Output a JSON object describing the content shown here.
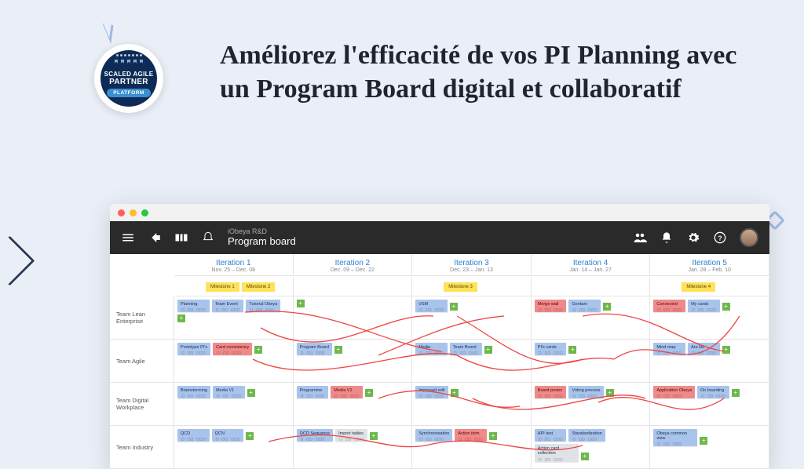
{
  "hero": {
    "headline": "Améliorez l'efficacité de vos PI Planning avec un Program Board digital et collaboratif",
    "badge_line1": "SCALED AGILE",
    "badge_line2": "PARTNER",
    "badge_pill": "PLATFORM"
  },
  "app": {
    "subtitle": "iObeya R&D",
    "title": "Program board"
  },
  "columns": [
    {
      "name": "Iteration 1",
      "date": "Nov. 25 – Dec. 08"
    },
    {
      "name": "Iteration 2",
      "date": "Dec. 09 – Dec. 22"
    },
    {
      "name": "Iteration 3",
      "date": "Dec. 23 – Jan. 13"
    },
    {
      "name": "Iteration 4",
      "date": "Jan. 14 – Jan. 27"
    },
    {
      "name": "Iteration 5",
      "date": "Jan. 28 – Feb. 10"
    }
  ],
  "milestones": [
    [
      "Milestone 1",
      "Milestone 2"
    ],
    [],
    [
      "Milestone 3"
    ],
    [],
    [
      "Milestone 4"
    ]
  ],
  "teams": [
    "Team Lean Enterprise",
    "Team Agile",
    "Team Digital Workplace",
    "Team Industry"
  ],
  "grid": [
    [
      [
        {
          "t": "Planning",
          "c": "blue"
        },
        {
          "t": "Team Event",
          "c": "blue"
        },
        {
          "t": "Tutorial Obeya",
          "c": "blue"
        }
      ],
      [],
      [
        {
          "t": "VSM",
          "c": "blue"
        }
      ],
      [
        {
          "t": "Merge wall",
          "c": "red"
        },
        {
          "t": "Gentani",
          "c": "blue"
        }
      ],
      [
        {
          "t": "Connected",
          "c": "red"
        },
        {
          "t": "My cards",
          "c": "blue"
        }
      ]
    ],
    [
      [
        {
          "t": "Prototype PI's",
          "c": "blue"
        },
        {
          "t": "Card consistency",
          "c": "red"
        }
      ],
      [
        {
          "t": "Program Board",
          "c": "blue"
        }
      ],
      [
        {
          "t": "Media",
          "c": "blue"
        },
        {
          "t": "Team Board",
          "c": "blue"
        }
      ],
      [
        {
          "t": "PI's cards",
          "c": "blue"
        }
      ],
      [
        {
          "t": "Mind map",
          "c": "blue"
        },
        {
          "t": "Are list",
          "c": "blue"
        }
      ]
    ],
    [
      [
        {
          "t": "Brainstorming",
          "c": "blue"
        },
        {
          "t": "Media V1",
          "c": "blue"
        }
      ],
      [
        {
          "t": "Programme",
          "c": "blue"
        },
        {
          "t": "Media V1",
          "c": "red"
        }
      ],
      [
        {
          "t": "Improved edit",
          "c": "blue"
        }
      ],
      [
        {
          "t": "Board poster",
          "c": "red"
        },
        {
          "t": "Voting process",
          "c": "blue"
        }
      ],
      [
        {
          "t": "Application Obeya",
          "c": "red"
        },
        {
          "t": "On boarding",
          "c": "blue"
        }
      ]
    ],
    [
      [
        {
          "t": "QCD",
          "c": "blue"
        },
        {
          "t": "QCN",
          "c": "blue"
        }
      ],
      [
        {
          "t": "QCD Sequence",
          "c": "blue"
        },
        {
          "t": "Import tables",
          "c": "grey"
        }
      ],
      [
        {
          "t": "Synchronisation",
          "c": "blue"
        },
        {
          "t": "Action item",
          "c": "red"
        }
      ],
      [
        {
          "t": "API test",
          "c": "blue"
        },
        {
          "t": "Standardization",
          "c": "blue"
        },
        {
          "t": "Action card collection",
          "c": "grey"
        }
      ],
      [
        {
          "t": "Obeya common view",
          "c": "blue"
        }
      ]
    ]
  ]
}
